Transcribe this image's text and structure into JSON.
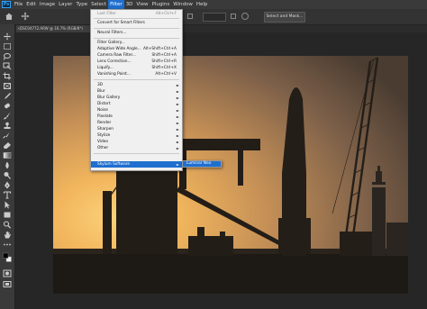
{
  "menubar": {
    "items": [
      {
        "label": "File"
      },
      {
        "label": "Edit"
      },
      {
        "label": "Image"
      },
      {
        "label": "Layer"
      },
      {
        "label": "Type"
      },
      {
        "label": "Select"
      },
      {
        "label": "Filter"
      },
      {
        "label": "3D"
      },
      {
        "label": "View"
      },
      {
        "label": "Plugins"
      },
      {
        "label": "Window"
      },
      {
        "label": "Help"
      }
    ],
    "logo": "Ps"
  },
  "options": {
    "select_and_mask": "Select and Mask..."
  },
  "document": {
    "tab_title": "DSC04772.ARW @ 16.7% (RGB/8*)",
    "tab_close": "×"
  },
  "filter_menu": {
    "last_filter": {
      "label": "Last Filter",
      "shortcut": "Alt+Ctrl+F"
    },
    "convert_smart": {
      "label": "Convert for Smart Filters"
    },
    "neural": {
      "label": "Neural Filters..."
    },
    "gallery": [
      {
        "label": "Filter Gallery...",
        "shortcut": ""
      },
      {
        "label": "Adaptive Wide Angle...",
        "shortcut": "Alt+Shift+Ctrl+A"
      },
      {
        "label": "Camera Raw Filter...",
        "shortcut": "Shift+Ctrl+A"
      },
      {
        "label": "Lens Correction...",
        "shortcut": "Shift+Ctrl+R"
      },
      {
        "label": "Liquify...",
        "shortcut": "Shift+Ctrl+X"
      },
      {
        "label": "Vanishing Point...",
        "shortcut": "Alt+Ctrl+V"
      }
    ],
    "groups": [
      {
        "label": "3D"
      },
      {
        "label": "Blur"
      },
      {
        "label": "Blur Gallery"
      },
      {
        "label": "Distort"
      },
      {
        "label": "Noise"
      },
      {
        "label": "Pixelate"
      },
      {
        "label": "Render"
      },
      {
        "label": "Sharpen"
      },
      {
        "label": "Stylize"
      },
      {
        "label": "Video"
      },
      {
        "label": "Other"
      }
    ],
    "plugin": {
      "label": "Skylum Software"
    },
    "submenu_item": "Luminar Neo"
  },
  "colors": {
    "accent": "#1f6fcf",
    "sky_top": "#d9b98a",
    "sky_glow": "#f7c66a",
    "silhouette": "#231d17"
  }
}
